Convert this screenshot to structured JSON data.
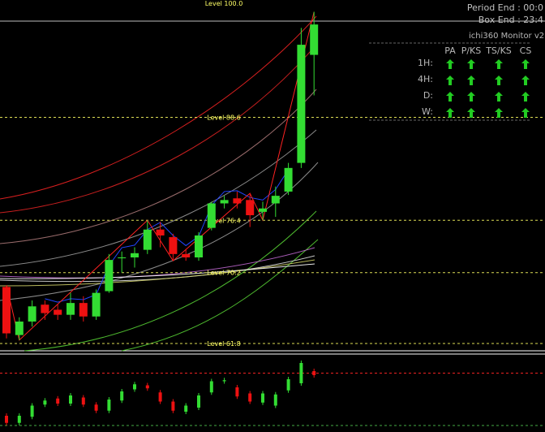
{
  "header": {
    "period_end": "Period End : 00:0",
    "box_end": "Box End : 23:4"
  },
  "monitor": {
    "title": "ichi360 Monitor v2",
    "columns": [
      "PA",
      "P/KS",
      "TS/KS",
      "CS"
    ],
    "rows": [
      {
        "label": "1H:",
        "signals": [
          "up",
          "up",
          "up",
          "up"
        ]
      },
      {
        "label": "4H:",
        "signals": [
          "up",
          "up",
          "up",
          "up"
        ]
      },
      {
        "label": "D:",
        "signals": [
          "up",
          "up",
          "up",
          "up"
        ]
      },
      {
        "label": "W:",
        "signals": [
          "up",
          "up",
          "up",
          "up"
        ]
      }
    ],
    "arrow_color": "#22cc22"
  },
  "colors": {
    "bull": "#33dd33",
    "bear": "#ee1111",
    "level_line": "#dddd55",
    "zigzag": "#ff2222",
    "fast_ma": "#2244ff"
  },
  "chart_data": {
    "type": "candlestick",
    "levels": [
      {
        "label": "Level 100.0",
        "value": 100.0
      },
      {
        "label": "Level 88.6",
        "value": 88.6
      },
      {
        "label": "Level 76.4",
        "value": 76.4
      },
      {
        "label": "Level 70.2",
        "value": 70.2
      },
      {
        "label": "Level 61.8",
        "value": 61.8
      }
    ],
    "candles": [
      {
        "o": 68.5,
        "h": 68.7,
        "l": 62.4,
        "c": 63.0
      },
      {
        "o": 62.8,
        "h": 64.9,
        "l": 62.2,
        "c": 64.4
      },
      {
        "o": 64.4,
        "h": 66.9,
        "l": 63.8,
        "c": 66.2
      },
      {
        "o": 66.4,
        "h": 66.9,
        "l": 64.6,
        "c": 65.4
      },
      {
        "o": 65.8,
        "h": 66.4,
        "l": 64.6,
        "c": 65.2
      },
      {
        "o": 65.2,
        "h": 67.8,
        "l": 64.6,
        "c": 66.6
      },
      {
        "o": 66.6,
        "h": 67.4,
        "l": 64.4,
        "c": 65.0
      },
      {
        "o": 65.0,
        "h": 68.2,
        "l": 64.6,
        "c": 67.8
      },
      {
        "o": 68.0,
        "h": 72.4,
        "l": 67.8,
        "c": 71.7
      },
      {
        "o": 71.9,
        "h": 72.7,
        "l": 70.2,
        "c": 72.0
      },
      {
        "o": 72.0,
        "h": 73.2,
        "l": 70.8,
        "c": 72.5
      },
      {
        "o": 72.9,
        "h": 76.4,
        "l": 72.4,
        "c": 75.3
      },
      {
        "o": 75.3,
        "h": 76.2,
        "l": 73.2,
        "c": 74.6
      },
      {
        "o": 74.4,
        "h": 74.8,
        "l": 71.6,
        "c": 72.4
      },
      {
        "o": 72.4,
        "h": 73.0,
        "l": 71.6,
        "c": 72.0
      },
      {
        "o": 72.0,
        "h": 75.0,
        "l": 71.6,
        "c": 74.6
      },
      {
        "o": 75.5,
        "h": 78.6,
        "l": 75.2,
        "c": 78.4
      },
      {
        "o": 78.4,
        "h": 79.3,
        "l": 77.8,
        "c": 78.8
      },
      {
        "o": 79.0,
        "h": 79.8,
        "l": 77.8,
        "c": 78.4
      },
      {
        "o": 78.8,
        "h": 79.6,
        "l": 75.6,
        "c": 77.0
      },
      {
        "o": 77.4,
        "h": 78.6,
        "l": 76.4,
        "c": 77.8
      },
      {
        "o": 78.4,
        "h": 80.4,
        "l": 76.8,
        "c": 79.3
      },
      {
        "o": 79.8,
        "h": 83.2,
        "l": 79.4,
        "c": 82.6
      },
      {
        "o": 83.2,
        "h": 99.2,
        "l": 82.6,
        "c": 97.2
      },
      {
        "o": 96.0,
        "h": 101.1,
        "l": 91.2,
        "c": 99.6
      }
    ],
    "oscillator": [
      {
        "o": 0.8,
        "c": 0.1
      },
      {
        "o": 0.1,
        "c": 0.8
      },
      {
        "o": 0.7,
        "c": 1.8
      },
      {
        "o": 1.9,
        "c": 2.3
      },
      {
        "o": 2.5,
        "c": 2.0
      },
      {
        "o": 2.0,
        "c": 2.8
      },
      {
        "o": 2.6,
        "c": 1.9
      },
      {
        "o": 1.9,
        "c": 1.3
      },
      {
        "o": 1.3,
        "c": 2.4
      },
      {
        "o": 2.3,
        "c": 3.2
      },
      {
        "o": 3.4,
        "c": 3.9
      },
      {
        "o": 3.8,
        "c": 3.5
      },
      {
        "o": 3.1,
        "c": 2.2
      },
      {
        "o": 2.2,
        "c": 1.3
      },
      {
        "o": 1.2,
        "c": 1.8
      },
      {
        "o": 1.6,
        "c": 2.8
      },
      {
        "o": 3.1,
        "c": 4.2
      },
      {
        "o": 4.2,
        "c": 4.3
      },
      {
        "o": 3.6,
        "c": 2.7
      },
      {
        "o": 3.0,
        "c": 2.2
      },
      {
        "o": 2.1,
        "c": 3.0
      },
      {
        "o": 1.8,
        "c": 2.9
      },
      {
        "o": 3.3,
        "c": 4.4
      },
      {
        "o": 4.0,
        "c": 6.0
      },
      {
        "o": 5.2,
        "c": 4.8
      }
    ],
    "oscillator_level": 5.0
  }
}
